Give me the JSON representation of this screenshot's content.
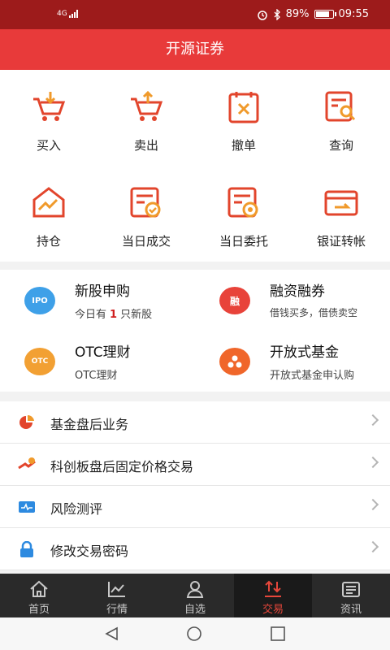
{
  "status_bar": {
    "network": "4G",
    "battery_percent": "89%",
    "battery_level": 0.89,
    "time": "09:55"
  },
  "header": {
    "title": "开源证券"
  },
  "colors": {
    "header_red": "#e83a3a",
    "status_red": "#9d1b1b",
    "icon_red": "#e2452c",
    "icon_orange": "#f09a2b",
    "tab_active": "#e6473b"
  },
  "quick_actions": [
    {
      "label": "买入",
      "icon": "cart-down-icon"
    },
    {
      "label": "卖出",
      "icon": "cart-up-icon"
    },
    {
      "label": "撤单",
      "icon": "cancel-order-icon"
    },
    {
      "label": "查询",
      "icon": "search-doc-icon"
    },
    {
      "label": "持仓",
      "icon": "holdings-house-icon"
    },
    {
      "label": "当日成交",
      "icon": "deal-doc-icon"
    },
    {
      "label": "当日委托",
      "icon": "entrust-doc-icon"
    },
    {
      "label": "银证转帐",
      "icon": "transfer-card-icon"
    }
  ],
  "services": {
    "ipo": {
      "badge": "IPO",
      "title": "新股申购",
      "sub_prefix": "今日有",
      "count": "1",
      "sub_suffix": "只新股"
    },
    "margin": {
      "badge": "融",
      "title": "融资融券",
      "sub": "借钱买多，借债卖空"
    },
    "otc": {
      "badge": "OTC",
      "title": "OTC理财",
      "sub": "OTC理财"
    },
    "fund": {
      "title": "开放式基金",
      "sub": "开放式基金申认购"
    }
  },
  "list": [
    {
      "label": "基金盘后业务",
      "icon": "pie-chart-icon"
    },
    {
      "label": "科创板盘后固定价格交易",
      "icon": "star-market-icon"
    },
    {
      "label": "风险测评",
      "icon": "risk-wave-icon"
    },
    {
      "label": "修改交易密码",
      "icon": "lock-icon"
    }
  ],
  "tabs": [
    {
      "label": "首页",
      "icon": "home-icon"
    },
    {
      "label": "行情",
      "icon": "chart-line-icon"
    },
    {
      "label": "自选",
      "icon": "person-icon"
    },
    {
      "label": "交易",
      "icon": "trade-icon"
    },
    {
      "label": "资讯",
      "icon": "news-icon"
    }
  ]
}
